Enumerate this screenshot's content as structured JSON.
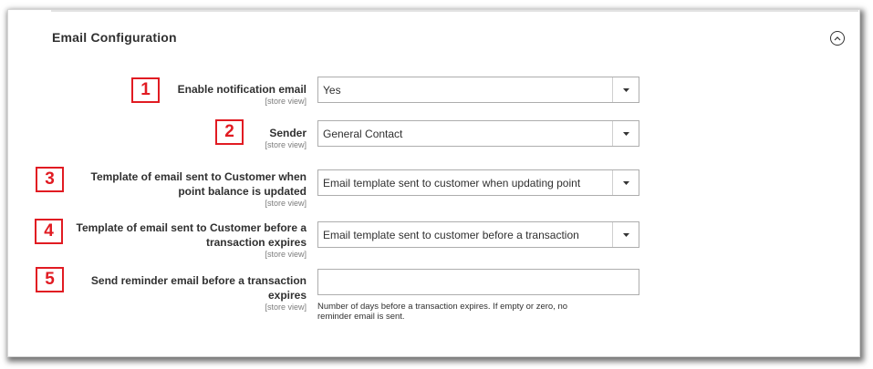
{
  "section": {
    "title": "Email Configuration",
    "collapse_icon": "chevron-up-circle-icon"
  },
  "fields": [
    {
      "badge": "1",
      "label": "Enable notification email",
      "scope": "[store view]",
      "type": "select",
      "value": "Yes"
    },
    {
      "badge": "2",
      "label": "Sender",
      "scope": "[store view]",
      "type": "select",
      "value": "General Contact"
    },
    {
      "badge": "3",
      "label_line1": "Template of email sent to Customer when",
      "label_line2": "point balance is updated",
      "scope": "[store view]",
      "type": "select",
      "value": "Email template sent to customer when updating point"
    },
    {
      "badge": "4",
      "label_line1": "Template of email sent to Customer before a",
      "label_line2": "transaction expires",
      "scope": "[store view]",
      "type": "select",
      "value": "Email template sent to customer before a transaction"
    },
    {
      "badge": "5",
      "label_line1": "Send reminder email before a transaction",
      "label_line2": "expires",
      "scope": "[store view]",
      "type": "text",
      "value": "",
      "note_line1": "Number of days before a transaction expires. If empty or zero, no",
      "note_line2": "reminder email is sent."
    }
  ],
  "colors": {
    "badge": "#e11b22",
    "border": "#adadad",
    "text": "#303030",
    "scope_text": "#7d7d7d"
  }
}
